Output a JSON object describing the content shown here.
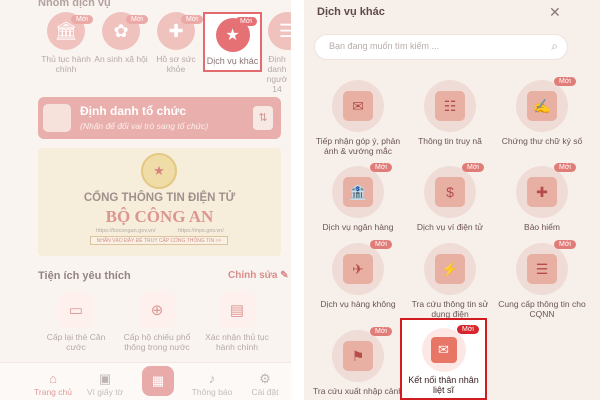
{
  "left": {
    "section_title": "Nhóm dịch vụ",
    "services": [
      {
        "label": "Thủ tục hành chính",
        "icon": "government-building-icon",
        "badge": "Mới"
      },
      {
        "label": "An sinh xã hội",
        "icon": "social-welfare-icon",
        "badge": "Mới"
      },
      {
        "label": "Hồ sơ sức khỏe",
        "icon": "health-record-icon",
        "badge": "Mới"
      },
      {
        "label": "Dịch vụ khác",
        "icon": "star-tray-icon",
        "badge": "Mới"
      },
      {
        "label": "Định danh ngườ 14",
        "icon": "id-icon",
        "badge": ""
      }
    ],
    "org": {
      "title": "Định danh tổ chức",
      "subtitle": "(Nhấn để đổi vai trò sang tổ chức)"
    },
    "banner": {
      "line1": "CỔNG THÔNG TIN ĐIỆN TỬ",
      "line2": "BỘ CÔNG AN",
      "site1": "https://bocongan.gov.vn/",
      "site2": "https://mps.gov.vn/",
      "button": "NHẤN VÀO ĐÂY ĐỂ TRUY CẬP CỔNG THÔNG TIN >>"
    },
    "utilities_title": "Tiện ích yêu thích",
    "edit_label": "Chỉnh sửa",
    "utilities": [
      {
        "label": "Cấp lại thẻ Căn cước"
      },
      {
        "label": "Cấp hộ chiếu phổ thông trong nước"
      },
      {
        "label": "Xác nhận thủ tục hành chính"
      }
    ],
    "tabs": [
      {
        "label": "Trang chủ"
      },
      {
        "label": "Ví giấy tờ"
      },
      {
        "label": "Thông báo"
      },
      {
        "label": "Cài đặt"
      }
    ]
  },
  "right": {
    "title": "Dịch vụ khác",
    "search_placeholder": "Bạn đang muốn tìm kiếm ...",
    "badge": "Mới",
    "services": [
      {
        "label": "Tiếp nhận góp ý, phản ánh & vướng mắc",
        "badge": ""
      },
      {
        "label": "Thông tin truy nã",
        "badge": ""
      },
      {
        "label": "Chứng thư chữ ký số",
        "badge": "Mới"
      },
      {
        "label": "Dịch vụ ngân hàng",
        "badge": "Mới"
      },
      {
        "label": "Dịch vụ ví điện tử",
        "badge": "Mới"
      },
      {
        "label": "Bảo hiểm",
        "badge": "Mới"
      },
      {
        "label": "Dịch vụ hàng không",
        "badge": "Mới"
      },
      {
        "label": "Tra cứu thông tin sử dụng điện",
        "badge": ""
      },
      {
        "label": "Cung cấp thông tin cho CQNN",
        "badge": "Mới"
      },
      {
        "label": "Tra cứu xuất nhập cảnh",
        "badge": "Mới"
      },
      {
        "label": "Kết nối thân nhân liệt sĩ",
        "badge": "Mới"
      }
    ]
  },
  "colors": {
    "highlight": "#d11d22",
    "accent": "#dd7f7b",
    "badge": "#e07d79"
  }
}
